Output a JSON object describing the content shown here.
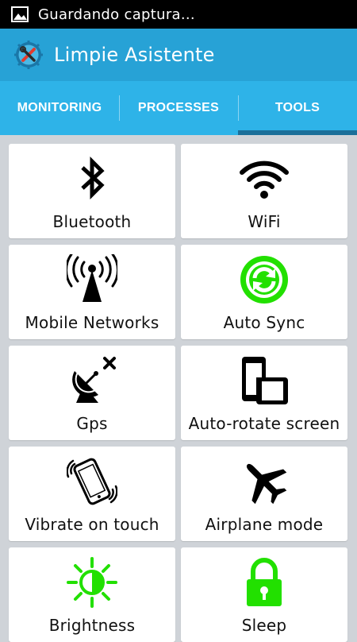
{
  "status_bar": {
    "notification_text": "Guardando captura..."
  },
  "app_bar": {
    "title": "Limpie Asistente",
    "icon": "tools-icon"
  },
  "tabs": [
    {
      "label": "MONITORING",
      "active": false
    },
    {
      "label": "PROCESSES",
      "active": false
    },
    {
      "label": "TOOLS",
      "active": true
    }
  ],
  "tools": [
    {
      "label": "Bluetooth",
      "icon": "bluetooth-icon"
    },
    {
      "label": "WiFi",
      "icon": "wifi-icon"
    },
    {
      "label": "Mobile Networks",
      "icon": "antenna-icon"
    },
    {
      "label": "Auto Sync",
      "icon": "sync-icon",
      "color": "#22e000"
    },
    {
      "label": "Gps",
      "icon": "satellite-dish-icon"
    },
    {
      "label": "Auto-rotate screen",
      "icon": "rotate-screen-icon"
    },
    {
      "label": "Vibrate on touch",
      "icon": "vibrate-phone-icon"
    },
    {
      "label": "Airplane mode",
      "icon": "airplane-icon"
    },
    {
      "label": "Brightness",
      "icon": "brightness-icon",
      "color": "#22e000"
    },
    {
      "label": "Sleep",
      "icon": "lock-icon",
      "color": "#22e000"
    }
  ],
  "colors": {
    "app_bar": "#27a2d6",
    "tabs": "#2eb3e8",
    "tab_indicator": "#1b6f99",
    "accent_green": "#22e000"
  }
}
